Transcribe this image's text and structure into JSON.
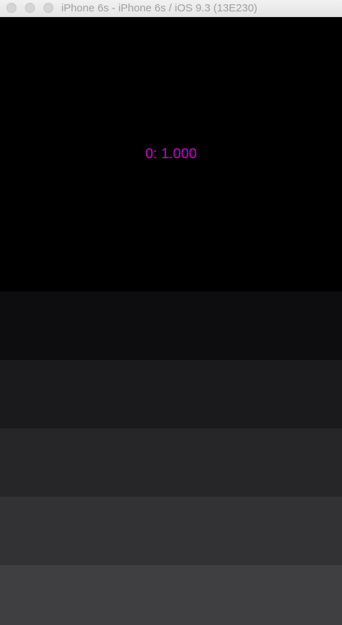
{
  "window": {
    "title": "iPhone 6s - iPhone 6s / iOS 9.3 (13E230)"
  },
  "screen": {
    "hero": {
      "label": "0: 1.000",
      "label_color": "#cc00cc",
      "background": "#000000"
    },
    "rows": [
      {
        "color": "#0d0c0f"
      },
      {
        "color": "#1a191c"
      },
      {
        "color": "#262528"
      },
      {
        "color": "#323134"
      },
      {
        "color": "#3f3e41"
      }
    ]
  },
  "icons": {
    "close": "close-icon",
    "minimize": "minimize-icon",
    "zoom": "zoom-icon"
  }
}
